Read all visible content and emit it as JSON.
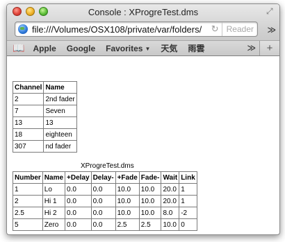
{
  "window": {
    "title": "Console : XProgreTest.dms",
    "fullscreen_icon": "fullscreen-arrows-icon"
  },
  "toolbar": {
    "url": "file:///Volumes/OSX108/private/var/folders/",
    "reader_label": "Reader",
    "overflow_label": "≫"
  },
  "bookmarks": {
    "items": [
      "Apple",
      "Google",
      "Favorites",
      "天気",
      "雨雲"
    ],
    "overflow_label": "≫",
    "newtab_label": "+"
  },
  "content": {
    "table1": {
      "headers": [
        "Channel",
        "Name"
      ],
      "rows": [
        [
          "2",
          "2nd fader"
        ],
        [
          "7",
          "Seven"
        ],
        [
          "13",
          "13"
        ],
        [
          "18",
          "eighteen"
        ],
        [
          "307",
          "nd fader"
        ]
      ]
    },
    "caption": "XProgreTest.dms",
    "table2": {
      "headers": [
        "Number",
        "Name",
        "+Delay",
        "Delay-",
        "+Fade",
        "Fade-",
        "Wait",
        "Link"
      ],
      "rows": [
        [
          "1",
          "Lo",
          "0.0",
          "0.0",
          "10.0",
          "10.0",
          "20.0",
          "1"
        ],
        [
          "2",
          "Hi 1",
          "0.0",
          "0.0",
          "10.0",
          "10.0",
          "20.0",
          "1"
        ],
        [
          "2.5",
          "Hi 2",
          "0.0",
          "0.0",
          "10.0",
          "10.0",
          "8.0",
          "-2"
        ],
        [
          "5",
          "Zero",
          "0.0",
          "0.0",
          "2.5",
          "2.5",
          "10.0",
          "0"
        ]
      ]
    }
  }
}
